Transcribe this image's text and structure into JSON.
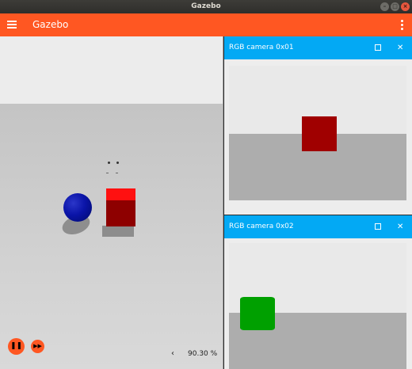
{
  "window": {
    "title": "Gazebo"
  },
  "appbar": {
    "title": "Gazebo"
  },
  "scene": {
    "real_time_factor": "90.30 %",
    "rtf_arrow": "‹"
  },
  "controls": {
    "play_glyph": "❚❚",
    "step_glyph": "▶▶"
  },
  "panels": [
    {
      "title": "RGB camera 0x01",
      "close_glyph": "✕"
    },
    {
      "title": "RGB camera 0x02",
      "close_glyph": "✕"
    }
  ],
  "colors": {
    "accent": "#ff5722",
    "panel_header": "#03a9f4",
    "red_box": "#a00000",
    "green_cylinder": "#00a000",
    "blue_sphere": "#0a14a8"
  }
}
